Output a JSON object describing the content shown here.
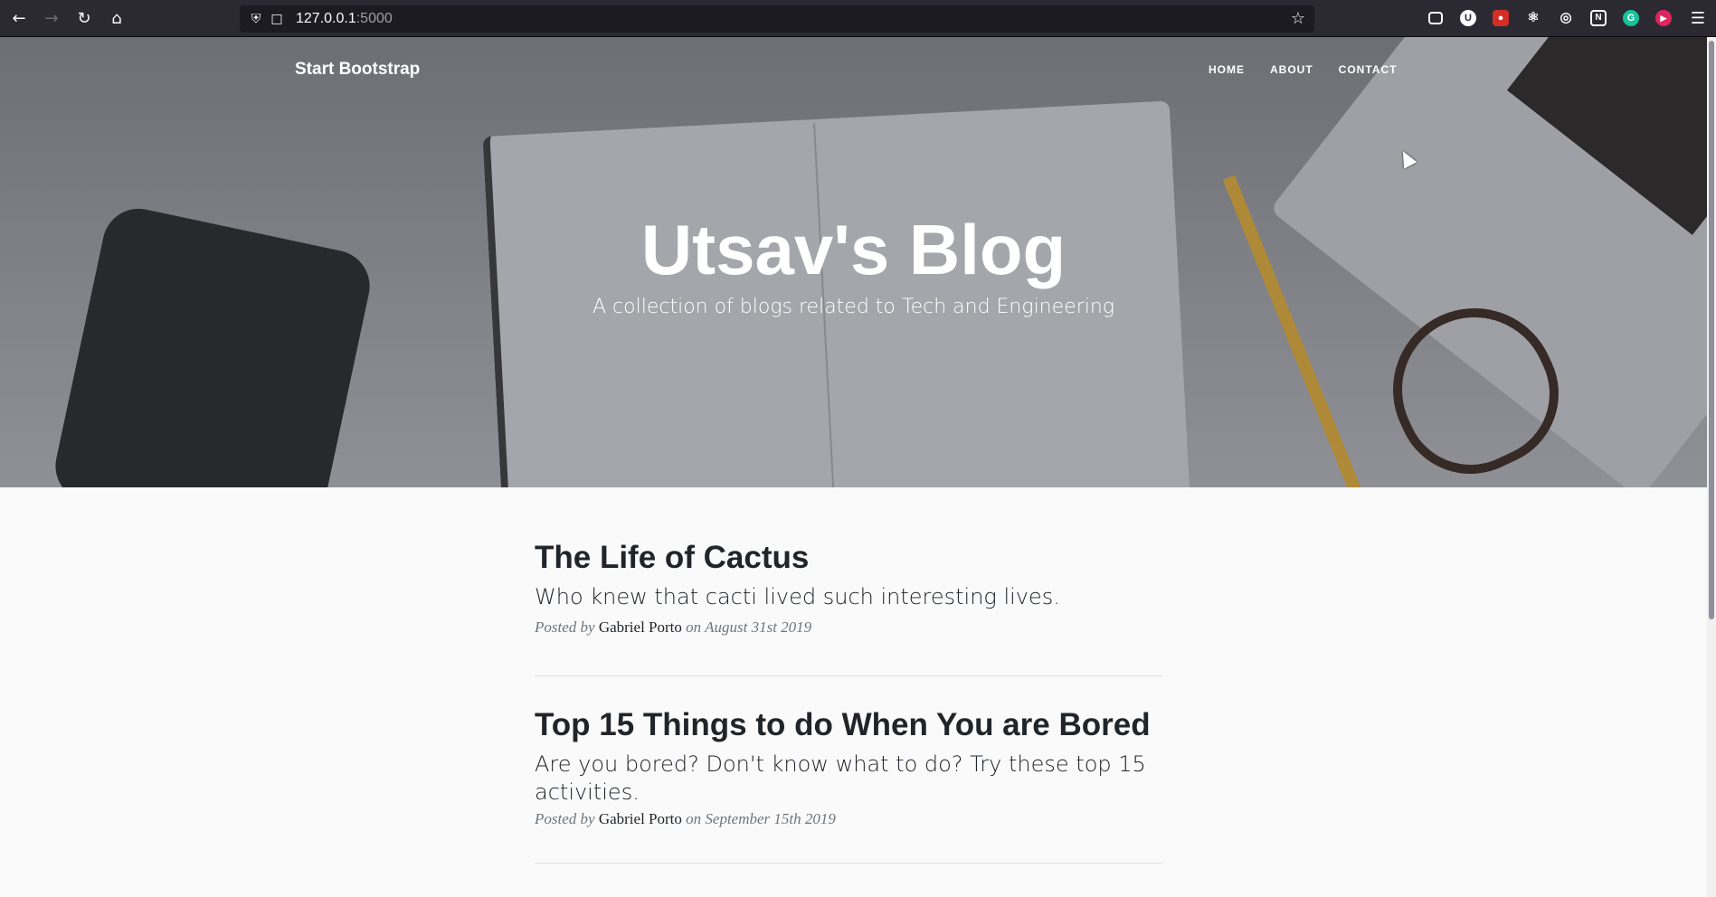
{
  "browser": {
    "url_host": "127.0.0.1",
    "url_port": ":5000",
    "back_icon": "arrow-left-icon",
    "forward_icon": "arrow-right-icon",
    "reload_icon": "reload-icon",
    "home_icon": "home-icon",
    "menu_icon": "hamburger-menu-icon",
    "extensions": [
      {
        "name": "pocket-icon",
        "color": "#2b2a33"
      },
      {
        "name": "ublock-icon",
        "color": "#2b2a33"
      },
      {
        "name": "lastpass-icon",
        "color": "#d32d27"
      },
      {
        "name": "react-devtools-icon",
        "color": "#2b2a33"
      },
      {
        "name": "globe-icon",
        "color": "#2b2a33"
      },
      {
        "name": "notion-icon",
        "color": "#2b2a33"
      },
      {
        "name": "grammarly-icon",
        "color": "#15c39a"
      },
      {
        "name": "recorder-icon",
        "color": "#e0245e"
      }
    ]
  },
  "nav": {
    "brand": "Start Bootstrap",
    "links": [
      "HOME",
      "ABOUT",
      "CONTACT"
    ]
  },
  "hero": {
    "title": "Utsav's Blog",
    "subtitle": "A collection of blogs related to Tech and Engineering"
  },
  "posts": [
    {
      "title": "The Life of Cactus",
      "subtitle": "Who knew that cacti lived such interesting lives.",
      "meta_prefix": "Posted by",
      "author": "Gabriel Porto",
      "meta_on": "on",
      "date": "August 31st 2019"
    },
    {
      "title": "Top 15 Things to do When You are Bored",
      "subtitle": "Are you bored? Don't know what to do? Try these top 15 activities.",
      "meta_prefix": "Posted by",
      "author": "Gabriel Porto",
      "meta_on": "on",
      "date": "September 15th 2019"
    }
  ]
}
